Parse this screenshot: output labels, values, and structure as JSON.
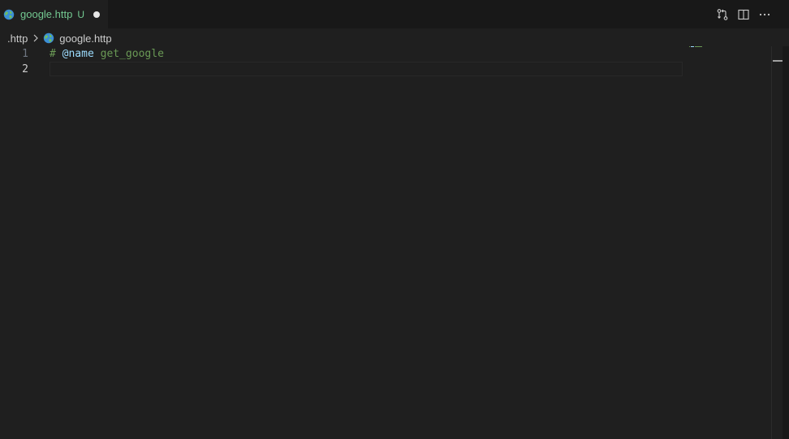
{
  "tab": {
    "label": "google.http",
    "status": "U",
    "icon": "globe-icon"
  },
  "breadcrumb": {
    "folder": ".http",
    "file": "google.http"
  },
  "editor": {
    "lines": [
      {
        "number": "1",
        "comment": "#",
        "keyword": "@name",
        "value": "get_google"
      },
      {
        "number": "2"
      }
    ]
  },
  "colors": {
    "tab_label": "#73c991",
    "background": "#1f1f1f",
    "comment": "#6a9955",
    "keyword": "#9cdcfe"
  }
}
